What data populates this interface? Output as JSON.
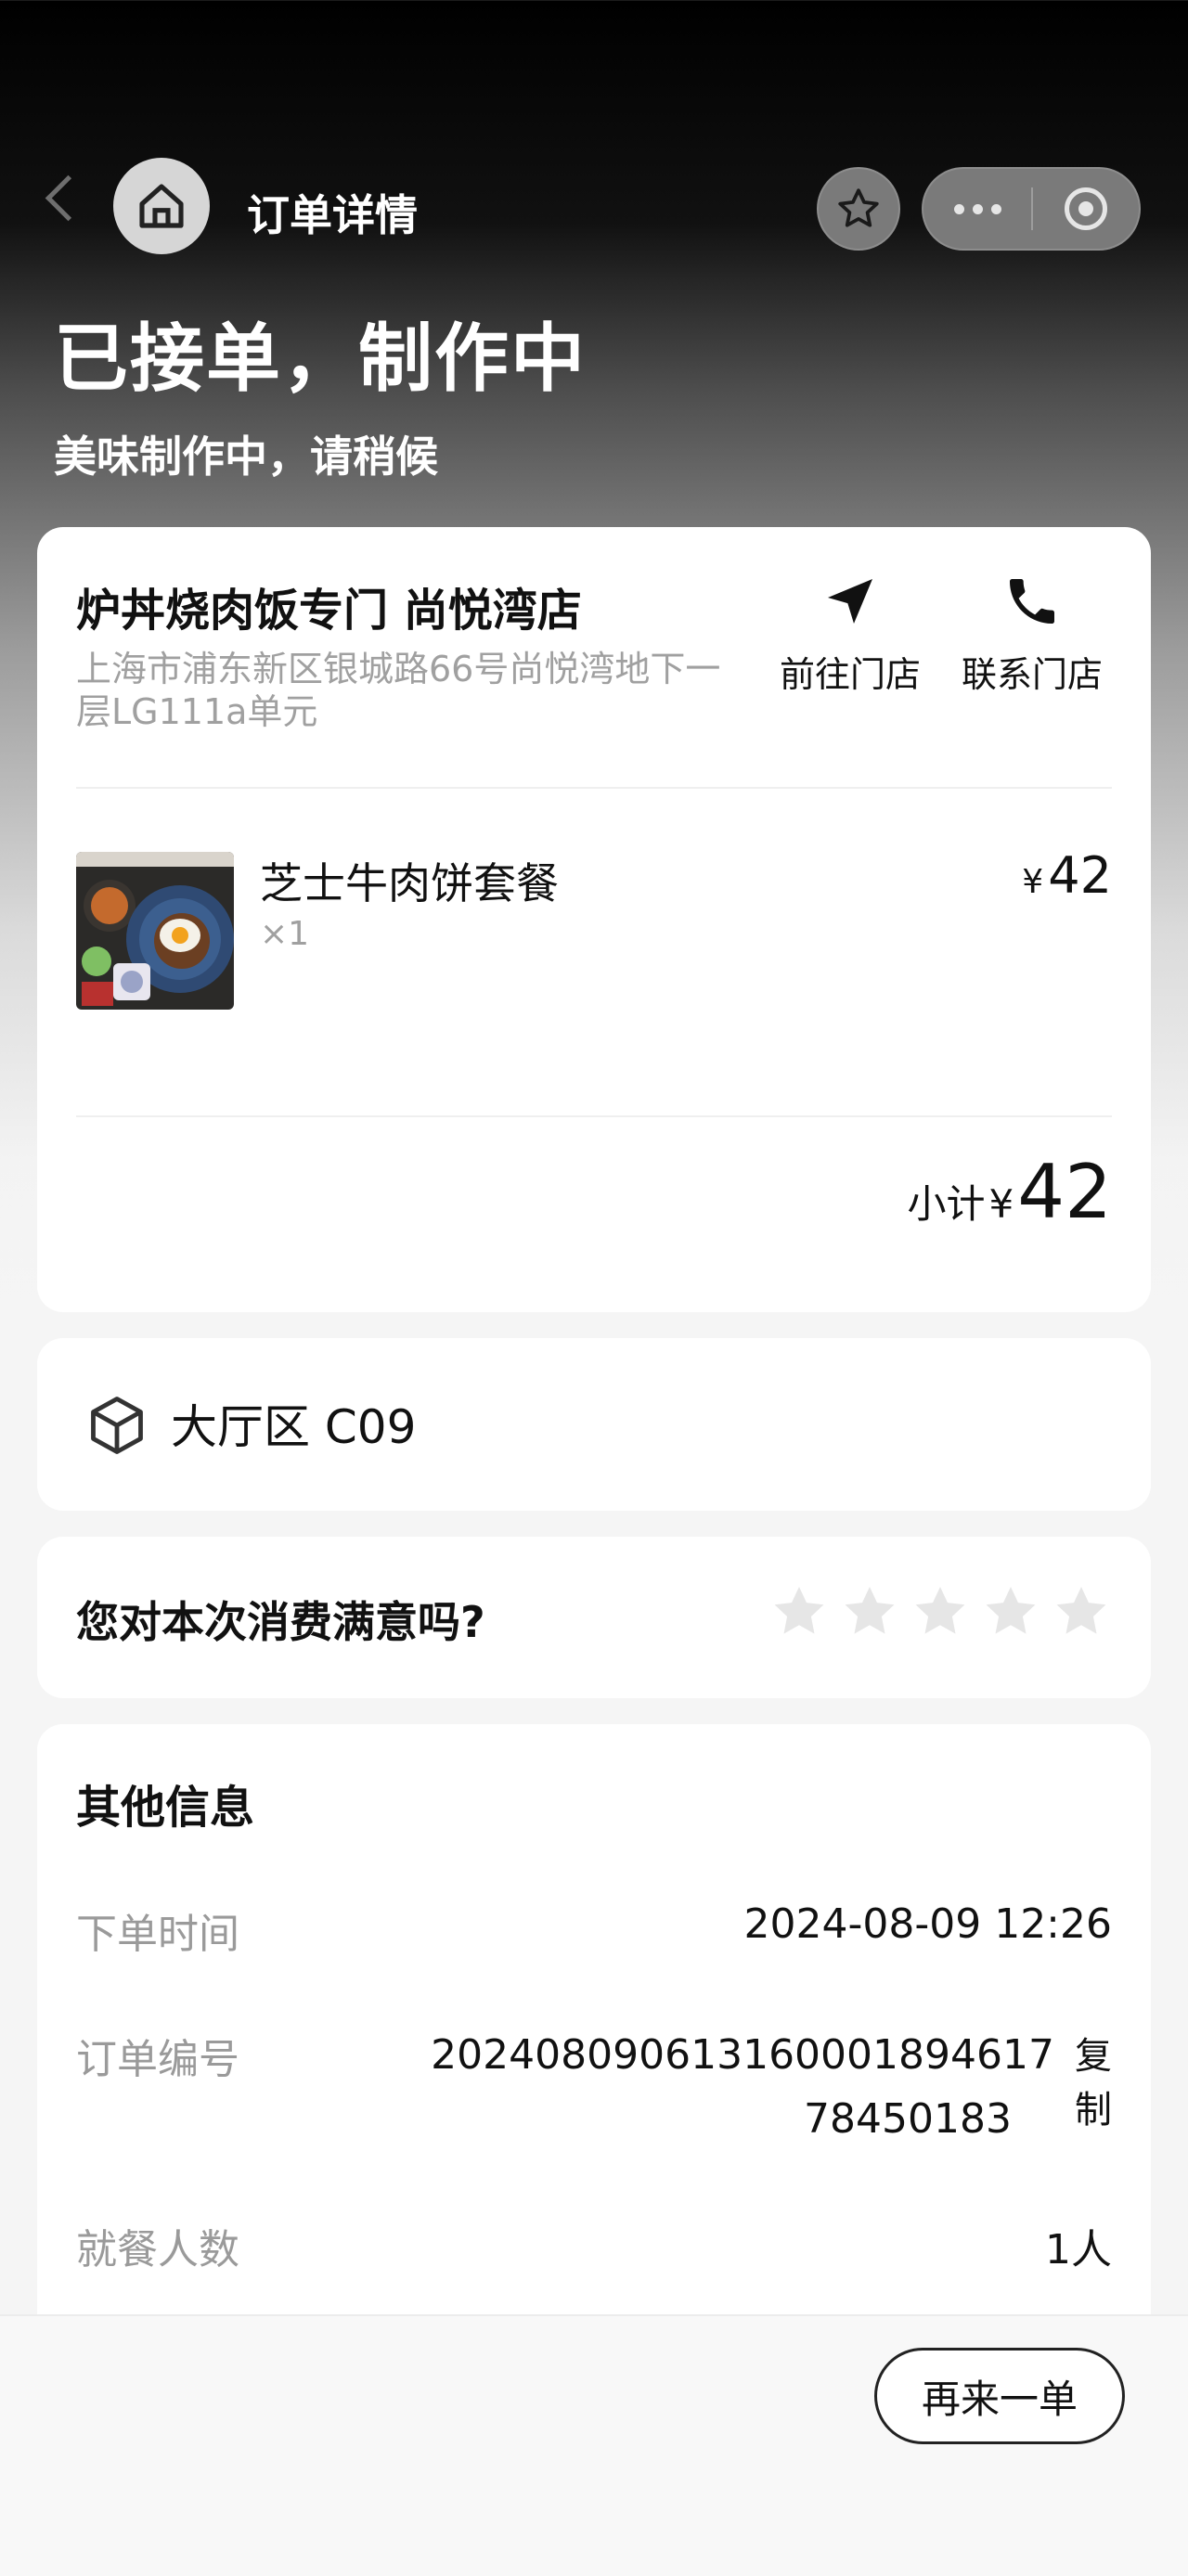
{
  "nav": {
    "title": "订单详情"
  },
  "status": {
    "title": "已接单，制作中",
    "subtitle": "美味制作中，请稍候"
  },
  "store": {
    "name": "炉丼烧肉饭专门 尚悦湾店",
    "address": "上海市浦东新区银城路66号尚悦湾地下一层LG111a单元",
    "navigate_label": "前往门店",
    "call_label": "联系门店"
  },
  "item": {
    "name": "芝士牛肉饼套餐",
    "qty": "×1",
    "currency": "¥",
    "price": "42"
  },
  "subtotal": {
    "label": "小计",
    "currency": "¥",
    "amount": "42"
  },
  "table": {
    "label": "大厅区 C09"
  },
  "rating": {
    "question": "您对本次消费满意吗?",
    "max_stars": 5,
    "selected": 0
  },
  "info": {
    "heading": "其他信息",
    "order_time_label": "下单时间",
    "order_time": "2024-08-09 12:26",
    "order_no_label": "订单编号",
    "order_no_line1": "202408090613160001894617",
    "order_no_line2": "78450183",
    "copy_label": "复制",
    "diners_label": "就餐人数",
    "diners": "1人"
  },
  "footer": {
    "reorder_label": "再来一单"
  },
  "colors": {
    "accent": "#111111",
    "muted": "#a0a0a0",
    "star": "#e6e6e6"
  }
}
